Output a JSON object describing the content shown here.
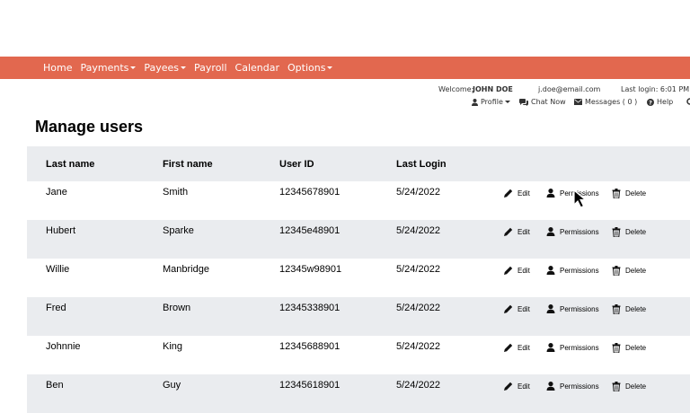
{
  "nav": {
    "items": [
      {
        "label": "Home",
        "dropdown": false
      },
      {
        "label": "Payments",
        "dropdown": true
      },
      {
        "label": "Payees",
        "dropdown": true
      },
      {
        "label": "Payroll",
        "dropdown": false
      },
      {
        "label": "Calendar",
        "dropdown": false
      },
      {
        "label": "Options",
        "dropdown": true
      }
    ],
    "color": "#e2684f"
  },
  "header": {
    "welcome_label": "Welcome:",
    "user_name": "JOHN DOE",
    "email": "j.doe@email.com",
    "last_login": "Last login: 6:01 PM ET",
    "profile_label": "Profile",
    "chat_label": "Chat Now",
    "messages_label": "Messages ( 0 )",
    "help_label": "Help"
  },
  "page": {
    "title": "Manage users"
  },
  "table": {
    "columns": [
      "Last name",
      "First name",
      "User ID",
      "Last Login"
    ],
    "rows": [
      {
        "last": "Jane",
        "first": "Smith",
        "id": "12345678901",
        "login": "5/24/2022"
      },
      {
        "last": "Hubert",
        "first": "Sparke",
        "id": "12345e48901",
        "login": "5/24/2022"
      },
      {
        "last": "Willie",
        "first": "Manbridge",
        "id": "12345w98901",
        "login": "5/24/2022"
      },
      {
        "last": "Fred",
        "first": "Brown",
        "id": "12345338901",
        "login": "5/24/2022"
      },
      {
        "last": "Johnnie",
        "first": "King",
        "id": "12345688901",
        "login": "5/24/2022"
      },
      {
        "last": "Ben",
        "first": "Guy",
        "id": "12345618901",
        "login": "5/24/2022"
      }
    ],
    "actions": {
      "edit": "Edit",
      "permissions": "Permissions",
      "delete": "Delete"
    }
  }
}
